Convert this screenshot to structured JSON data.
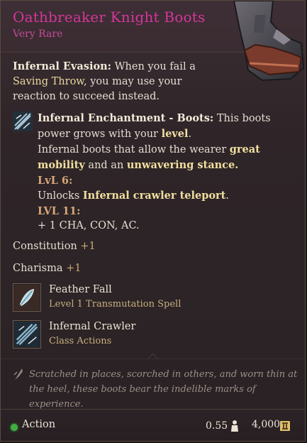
{
  "item": {
    "name": "Oathbreaker Knight Boots",
    "rarity": "Very Rare"
  },
  "evasion": {
    "label": "Infernal Evasion:",
    "t1": " When you fail a ",
    "link": "Saving Throw",
    "t2": ", you may use your reaction to succeed instead."
  },
  "enchant": {
    "label": "Infernal Enchantment - Boots:",
    "t1": " This boots power grows with your ",
    "level_word": "level",
    "t2": ".",
    "t3": "Infernal boots that allow the wearer ",
    "mobility": "great mobility",
    "t4": " and an ",
    "stance": "unwavering stance.",
    "lvl6_label": "LvL 6:",
    "lvl6_t1": "Unlocks ",
    "lvl6_feature": "Infernal crawler teleport",
    "lvl6_t2": ".",
    "lvl11_label": "LVL 11:",
    "lvl11_text": "+ 1 CHA, CON, AC."
  },
  "stats": [
    {
      "name": "Constitution",
      "value": "+1"
    },
    {
      "name": "Charisma",
      "value": "+1"
    }
  ],
  "spells": [
    {
      "name": "Feather Fall",
      "sub": "Level 1 Transmutation Spell",
      "icon": "feather-fall-icon"
    },
    {
      "name": "Infernal Crawler",
      "sub": "Class Actions",
      "icon": "infernal-crawler-icon"
    }
  ],
  "lore": {
    "text": "Scratched in places, scorched in others, and worn thin at the heel, these boots bear the indelible marks of experience."
  },
  "footer": {
    "action": "Action",
    "weight": "0.55",
    "price": "4,000"
  },
  "colors": {
    "title": "#d6359a",
    "accent_gold": "#e9d9a0",
    "action_dot": "#3fae3f"
  }
}
